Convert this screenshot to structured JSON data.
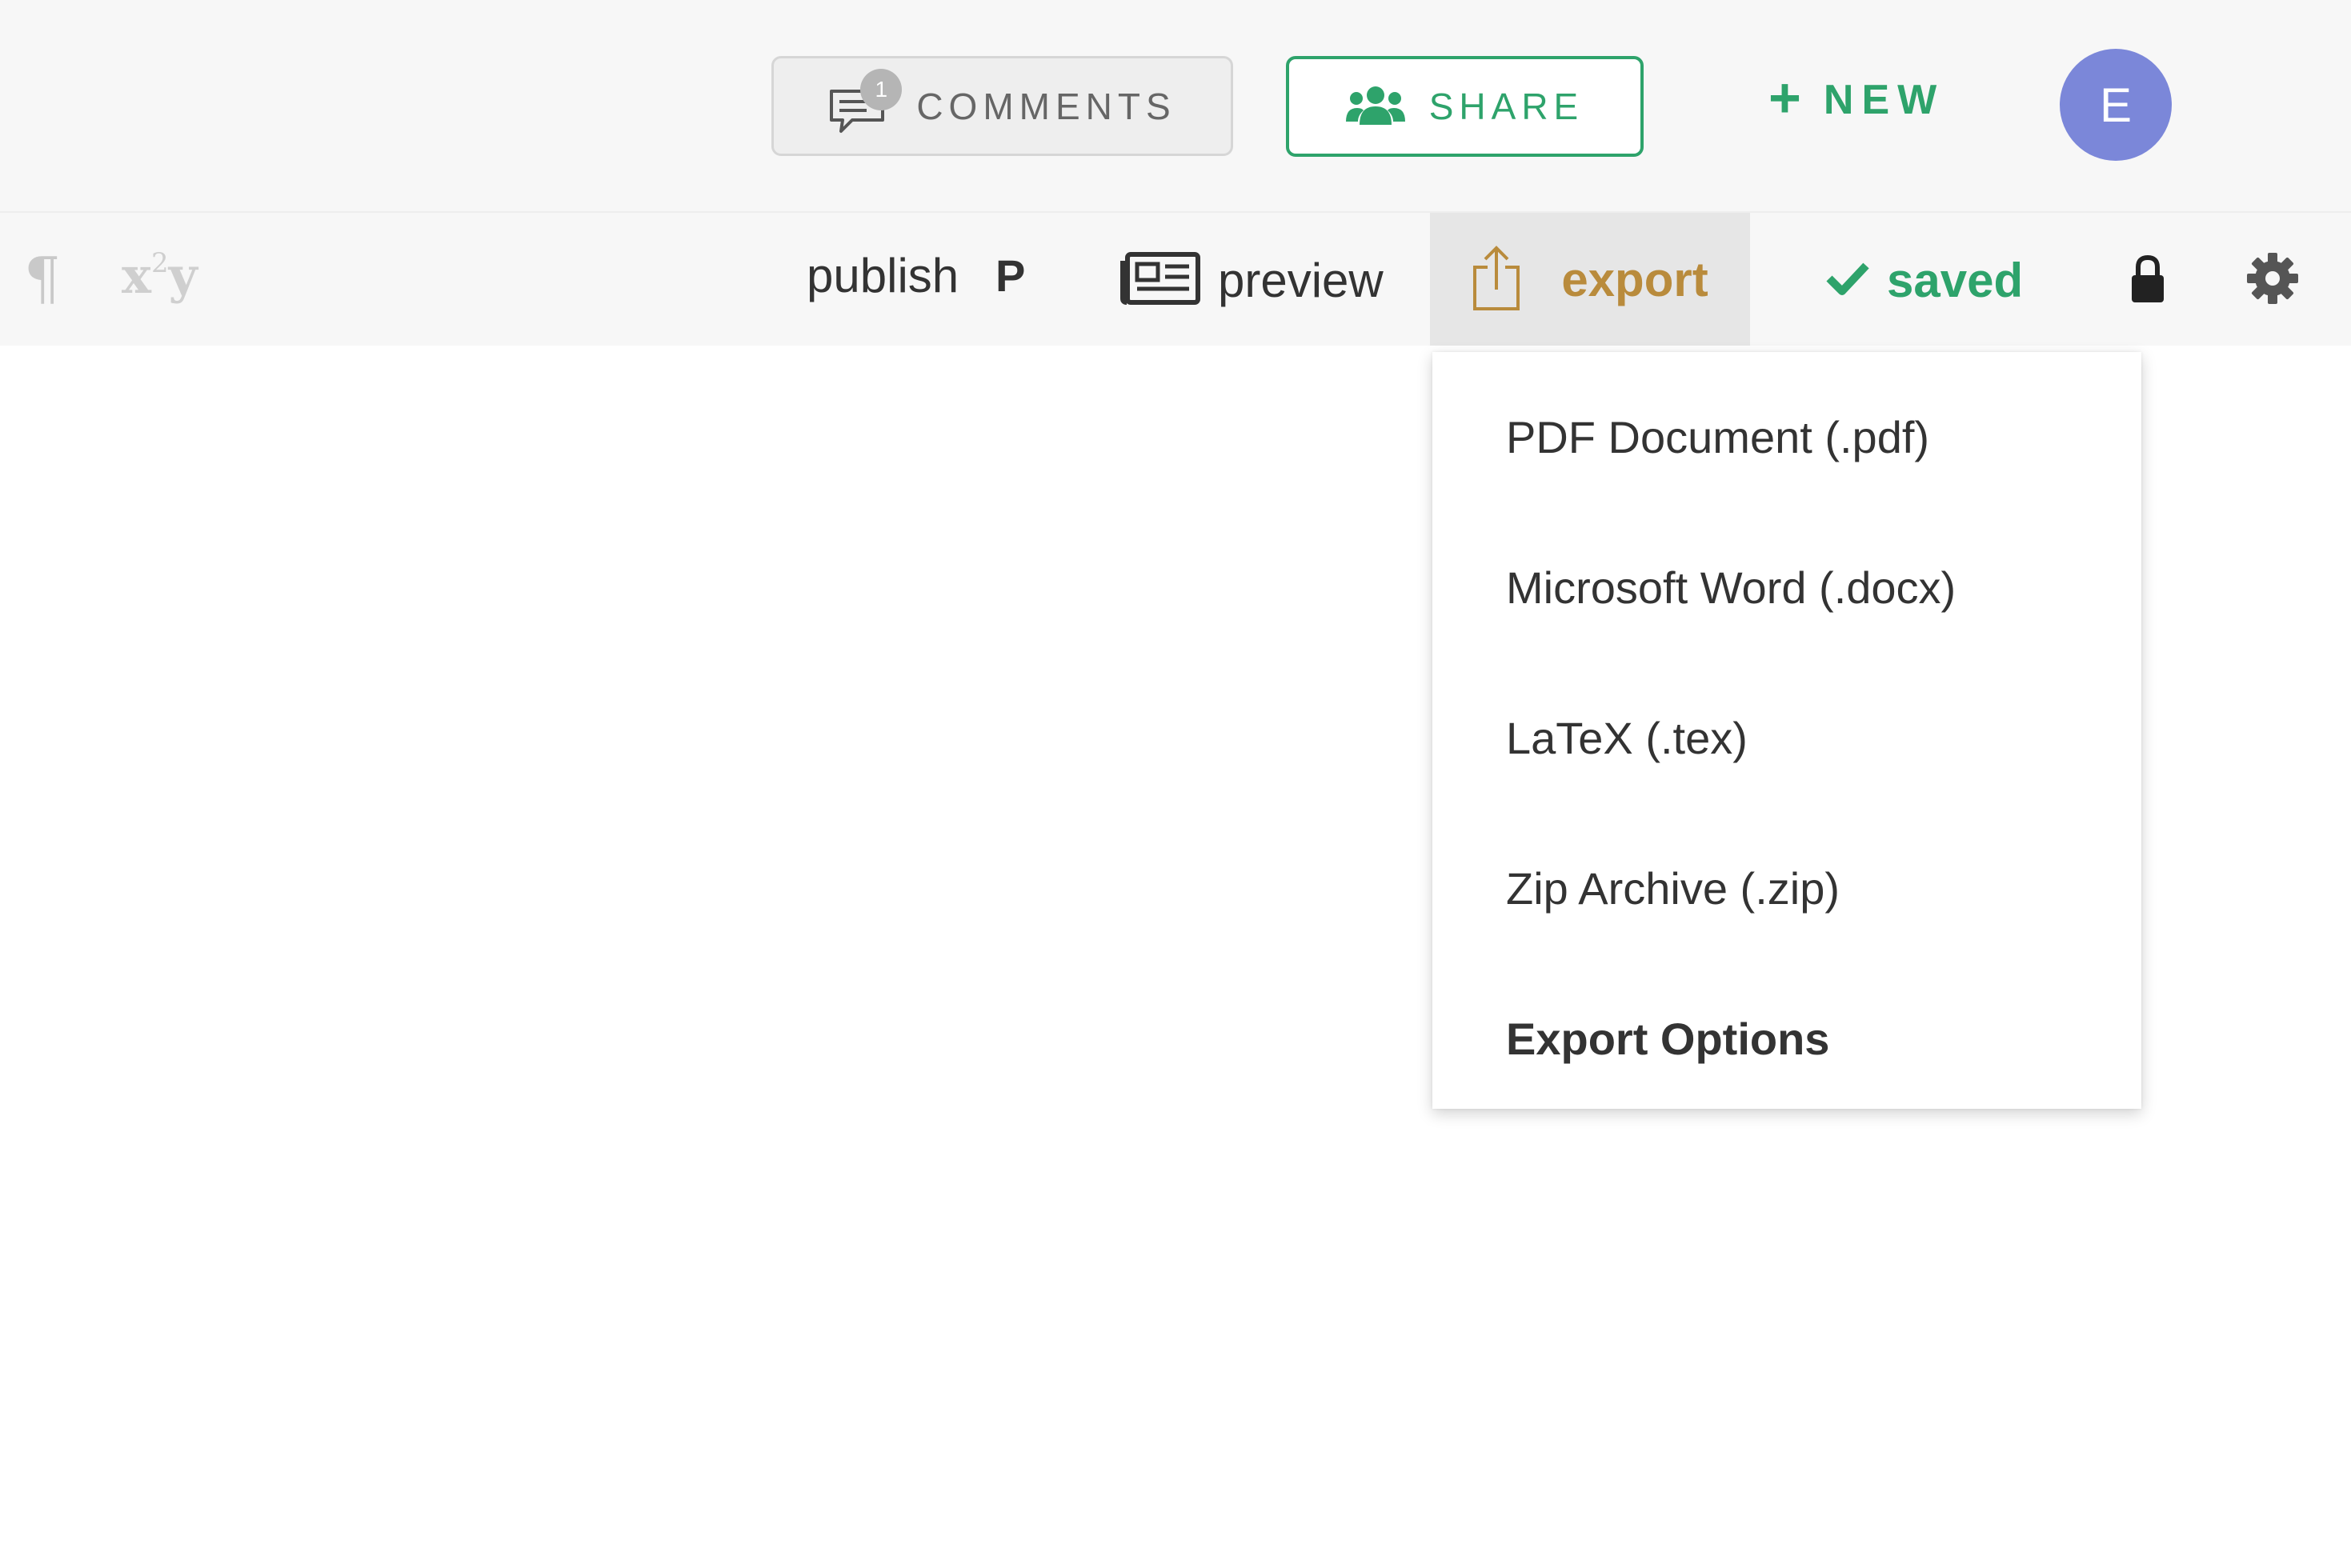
{
  "header": {
    "comments": {
      "label": "COMMENTS",
      "badge_count": "1",
      "icon": "comment-icon"
    },
    "share": {
      "label": "SHARE",
      "icon": "users-icon",
      "color": "#2ea36b"
    },
    "new": {
      "label": "NEW",
      "icon": "plus-icon",
      "plus_glyph": "+"
    },
    "avatar": {
      "initial": "E",
      "color": "#7b87d9"
    }
  },
  "toolbar": {
    "pilcrow_glyph": "¶",
    "formula": {
      "base": "x",
      "exponent": "2",
      "tail": "y"
    },
    "publish": {
      "label": "publish",
      "shortcut": "P"
    },
    "preview": {
      "label": "preview",
      "icon": "newspaper-icon"
    },
    "export": {
      "label": "export",
      "icon": "upload-icon",
      "color": "#b98b3c"
    },
    "saved": {
      "label": "saved",
      "icon": "check-icon",
      "color": "#2ea36b"
    },
    "lock_icon": "lock-icon",
    "settings_icon": "gear-icon"
  },
  "export_menu": {
    "items": [
      {
        "label": "PDF Document (.pdf)"
      },
      {
        "label": "Microsoft Word (.docx)"
      },
      {
        "label": "LaTeX (.tex)"
      },
      {
        "label": "Zip Archive (.zip)"
      }
    ],
    "options_label": "Export Options"
  }
}
